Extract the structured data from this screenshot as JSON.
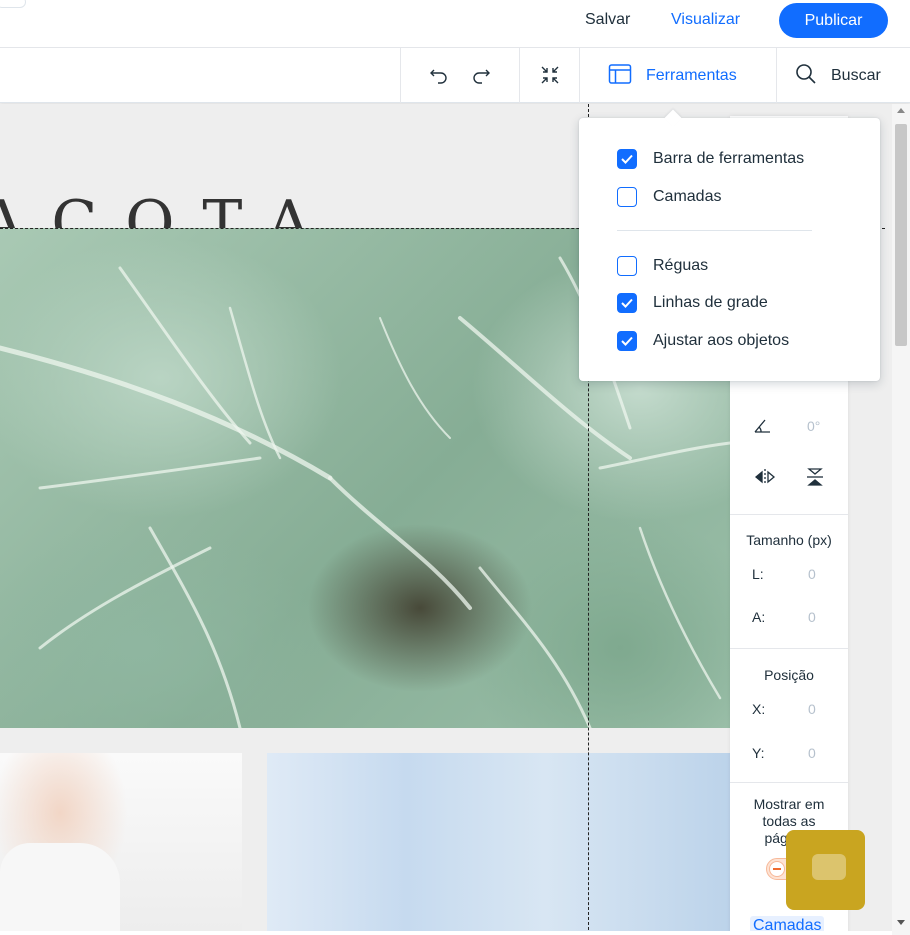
{
  "topbar": {
    "save_label": "Salvar",
    "preview_label": "Visualizar",
    "publish_label": "Publicar"
  },
  "toolbar": {
    "tools_label": "Ferramentas",
    "search_label": "Buscar"
  },
  "canvas": {
    "logo_text": "ACOTA"
  },
  "tools_menu": {
    "items": [
      {
        "label": "Barra de ferramentas",
        "checked": true
      },
      {
        "label": "Camadas",
        "checked": false
      },
      {
        "label": "Réguas",
        "checked": false
      },
      {
        "label": "Linhas de grade",
        "checked": true
      },
      {
        "label": "Ajustar aos objetos",
        "checked": true
      }
    ]
  },
  "inspector": {
    "rotation_value": "0°",
    "size_title": "Tamanho (px)",
    "width_label": "L:",
    "width_value": "0",
    "height_label": "A:",
    "height_value": "0",
    "position_title": "Posição",
    "x_label": "X:",
    "x_value": "0",
    "y_label": "Y:",
    "y_value": "0",
    "show_all_pages_label": "Mostrar em todas as páginas",
    "layers_link": "Camadas"
  },
  "colors": {
    "accent": "#116dff",
    "text": "#20303c",
    "muted": "#b6c1cd",
    "toggle_off": "#f06b2f",
    "chat": "#c9a520"
  }
}
